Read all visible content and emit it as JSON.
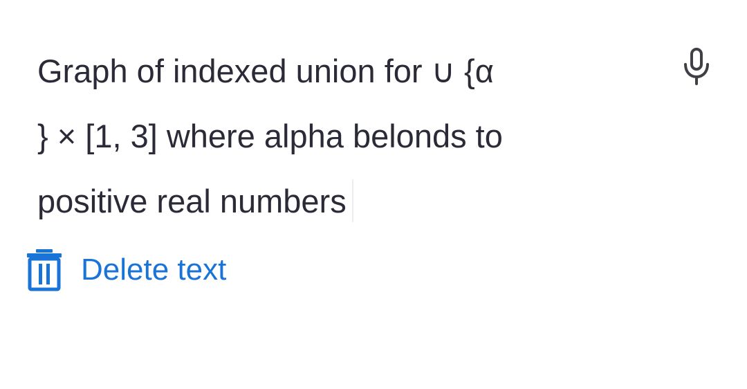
{
  "query": {
    "lines": [
      "Graph of indexed union for  ∪ {α",
      "} × [1, 3] where alpha belonds to",
      "positive real numbers"
    ]
  },
  "actions": {
    "delete_text": "Delete text"
  },
  "icons": {
    "microphone": "microphone-icon",
    "delete": "trash-icon"
  },
  "colors": {
    "text": "#2b2b38",
    "accent": "#1a73d6",
    "icon": "#3f3f45"
  }
}
